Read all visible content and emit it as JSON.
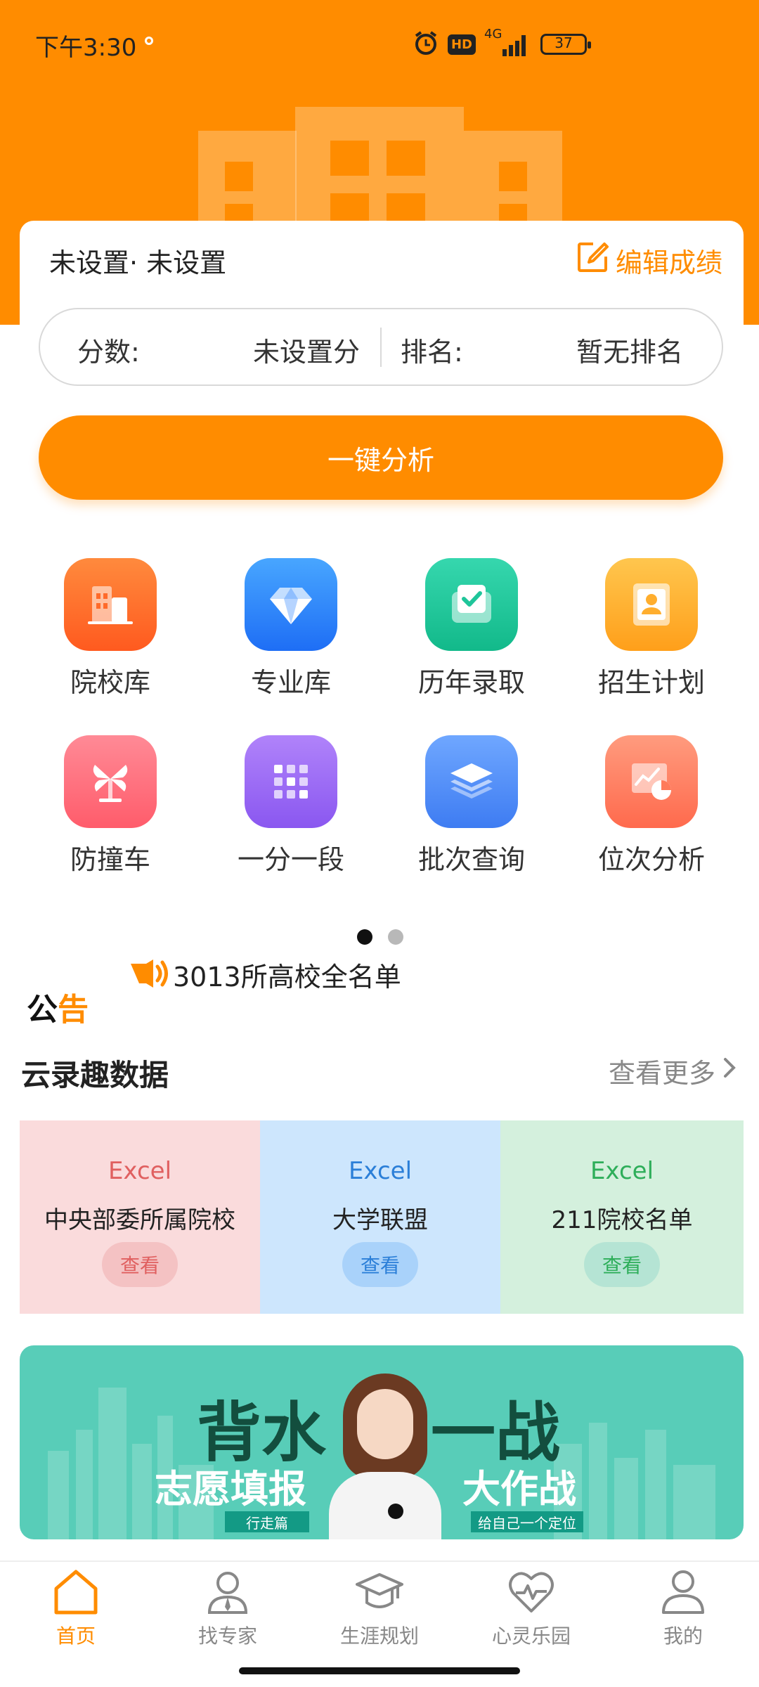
{
  "status_bar": {
    "time": "下午3:30",
    "hd": "HD",
    "network": "4G",
    "battery": "37"
  },
  "profile": {
    "location": "未设置· 未设置",
    "edit_label": "编辑成绩"
  },
  "score": {
    "score_label": "分数:",
    "score_value": "未设置分",
    "rank_label": "排名:",
    "rank_value": "暂无排名"
  },
  "analyze_button": "一键分析",
  "features": [
    {
      "label": "院校库",
      "icon": "building-icon",
      "color": "#FF6A2A"
    },
    {
      "label": "专业库",
      "icon": "diamond-icon",
      "color": "#2F83FF"
    },
    {
      "label": "历年录取",
      "icon": "check-board-icon",
      "color": "#1FC59A"
    },
    {
      "label": "招生计划",
      "icon": "id-card-icon",
      "color": "#FFAE2E"
    },
    {
      "label": "防撞车",
      "icon": "windmill-icon",
      "color": "#FF6F7C"
    },
    {
      "label": "一分一段",
      "icon": "grid-icon",
      "color": "#9A6BF5"
    },
    {
      "label": "批次查询",
      "icon": "layers-icon",
      "color": "#4E8DF7"
    },
    {
      "label": "位次分析",
      "icon": "chart-icon",
      "color": "#FF7A5A"
    }
  ],
  "pager": {
    "total": 2,
    "active": 0
  },
  "notice": {
    "logo_1": "公",
    "logo_2": "告",
    "text": "3013所高校全名单"
  },
  "section": {
    "title": "云录趣数据",
    "more": "查看更多"
  },
  "data_cards": [
    {
      "tag": "Excel",
      "title": "中央部委所属院校",
      "button": "查看",
      "bg": "#FADBDC",
      "accent": "#E06060",
      "btn_bg": "#F4C2C3"
    },
    {
      "tag": "Excel",
      "title": "大学联盟",
      "button": "查看",
      "bg": "#CDE6FD",
      "accent": "#2B7FD8",
      "btn_bg": "#A9D2FA"
    },
    {
      "tag": "Excel",
      "title": "211院校名单",
      "button": "查看",
      "bg": "#D4F0DD",
      "accent": "#2EAE5A",
      "btn_bg": "#B5E4D4"
    }
  ],
  "banner": {
    "headline_1": "背水",
    "headline_2": "一战",
    "sub_1": "志愿填报",
    "sub_2": "大作战",
    "tag_1": "行走篇",
    "tag_2": "给自己一个定位"
  },
  "tabs": [
    {
      "label": "首页",
      "icon": "home-icon",
      "active": true
    },
    {
      "label": "找专家",
      "icon": "expert-icon",
      "active": false
    },
    {
      "label": "生涯规划",
      "icon": "graduation-cap-icon",
      "active": false
    },
    {
      "label": "心灵乐园",
      "icon": "heart-pulse-icon",
      "active": false
    },
    {
      "label": "我的",
      "icon": "user-icon",
      "active": false
    }
  ],
  "colors": {
    "brand": "#FF8C00"
  }
}
